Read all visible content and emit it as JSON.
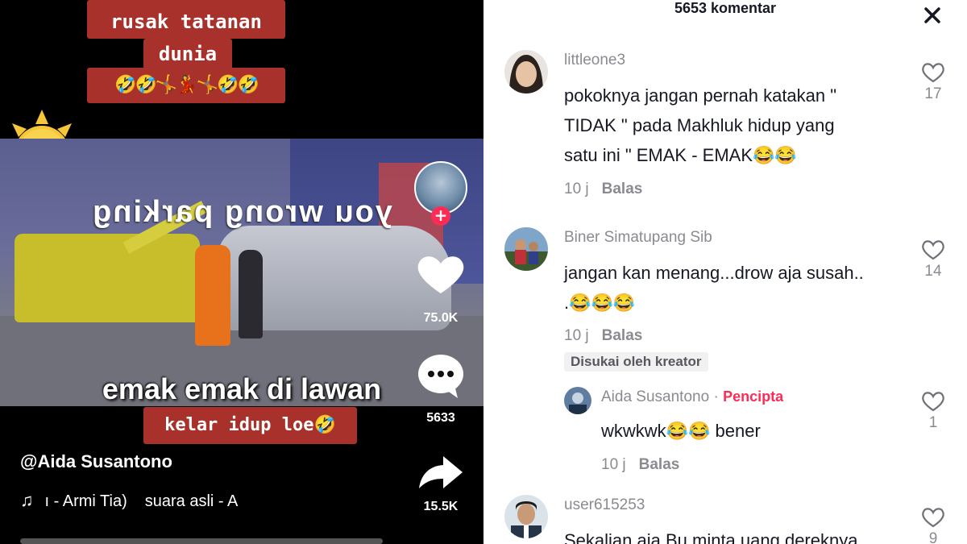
{
  "video": {
    "captions": {
      "line1": "rusak tatanan",
      "line2": "dunia",
      "line3": "🤣🤣🤸💃🤸🤣🤣",
      "bottom": "kelar idup loe🤣"
    },
    "overlay_mirrored": "you wrong parking",
    "overlay_main": "emak emak di lawan",
    "author": "@Aida Susantono",
    "music": {
      "part1": "ı - Armi Tia)",
      "part2": "suara asli - A"
    },
    "actions": {
      "likes": "75.0K",
      "comments": "5633",
      "shares": "15.5K"
    },
    "progress": 0.0
  },
  "comments_panel": {
    "title": "5653 komentar",
    "comments": [
      {
        "user": "littleone3",
        "lines": [
          "pokoknya jangan pernah katakan \"",
          "TIDAK \" pada Makhluk hidup yang",
          "satu ini \" EMAK - EMAK😂😂"
        ],
        "time": "10 j",
        "reply": "Balas",
        "likes": "17"
      },
      {
        "user": "Biner Simatupang Sib",
        "lines": [
          "jangan kan menang...drow aja susah..",
          ".😂😂😂"
        ],
        "time": "10 j",
        "reply": "Balas",
        "likes": "14",
        "badge": "Disukai oleh kreator"
      },
      {
        "user": "Aida Susantono",
        "creator_sep": "·",
        "creator_tag": "Pencipta",
        "lines": [
          "wkwkwk😂😂 bener"
        ],
        "time": "10 j",
        "reply": "Balas",
        "likes": "1"
      },
      {
        "user": "user615253",
        "lines": [
          "Sekalian aja Bu minta uang dereknya"
        ],
        "likes": "9"
      }
    ]
  },
  "colors": {
    "caption_red": "#a8312c",
    "accent_pink": "#fe2c55",
    "muted": "#8a8b91"
  }
}
